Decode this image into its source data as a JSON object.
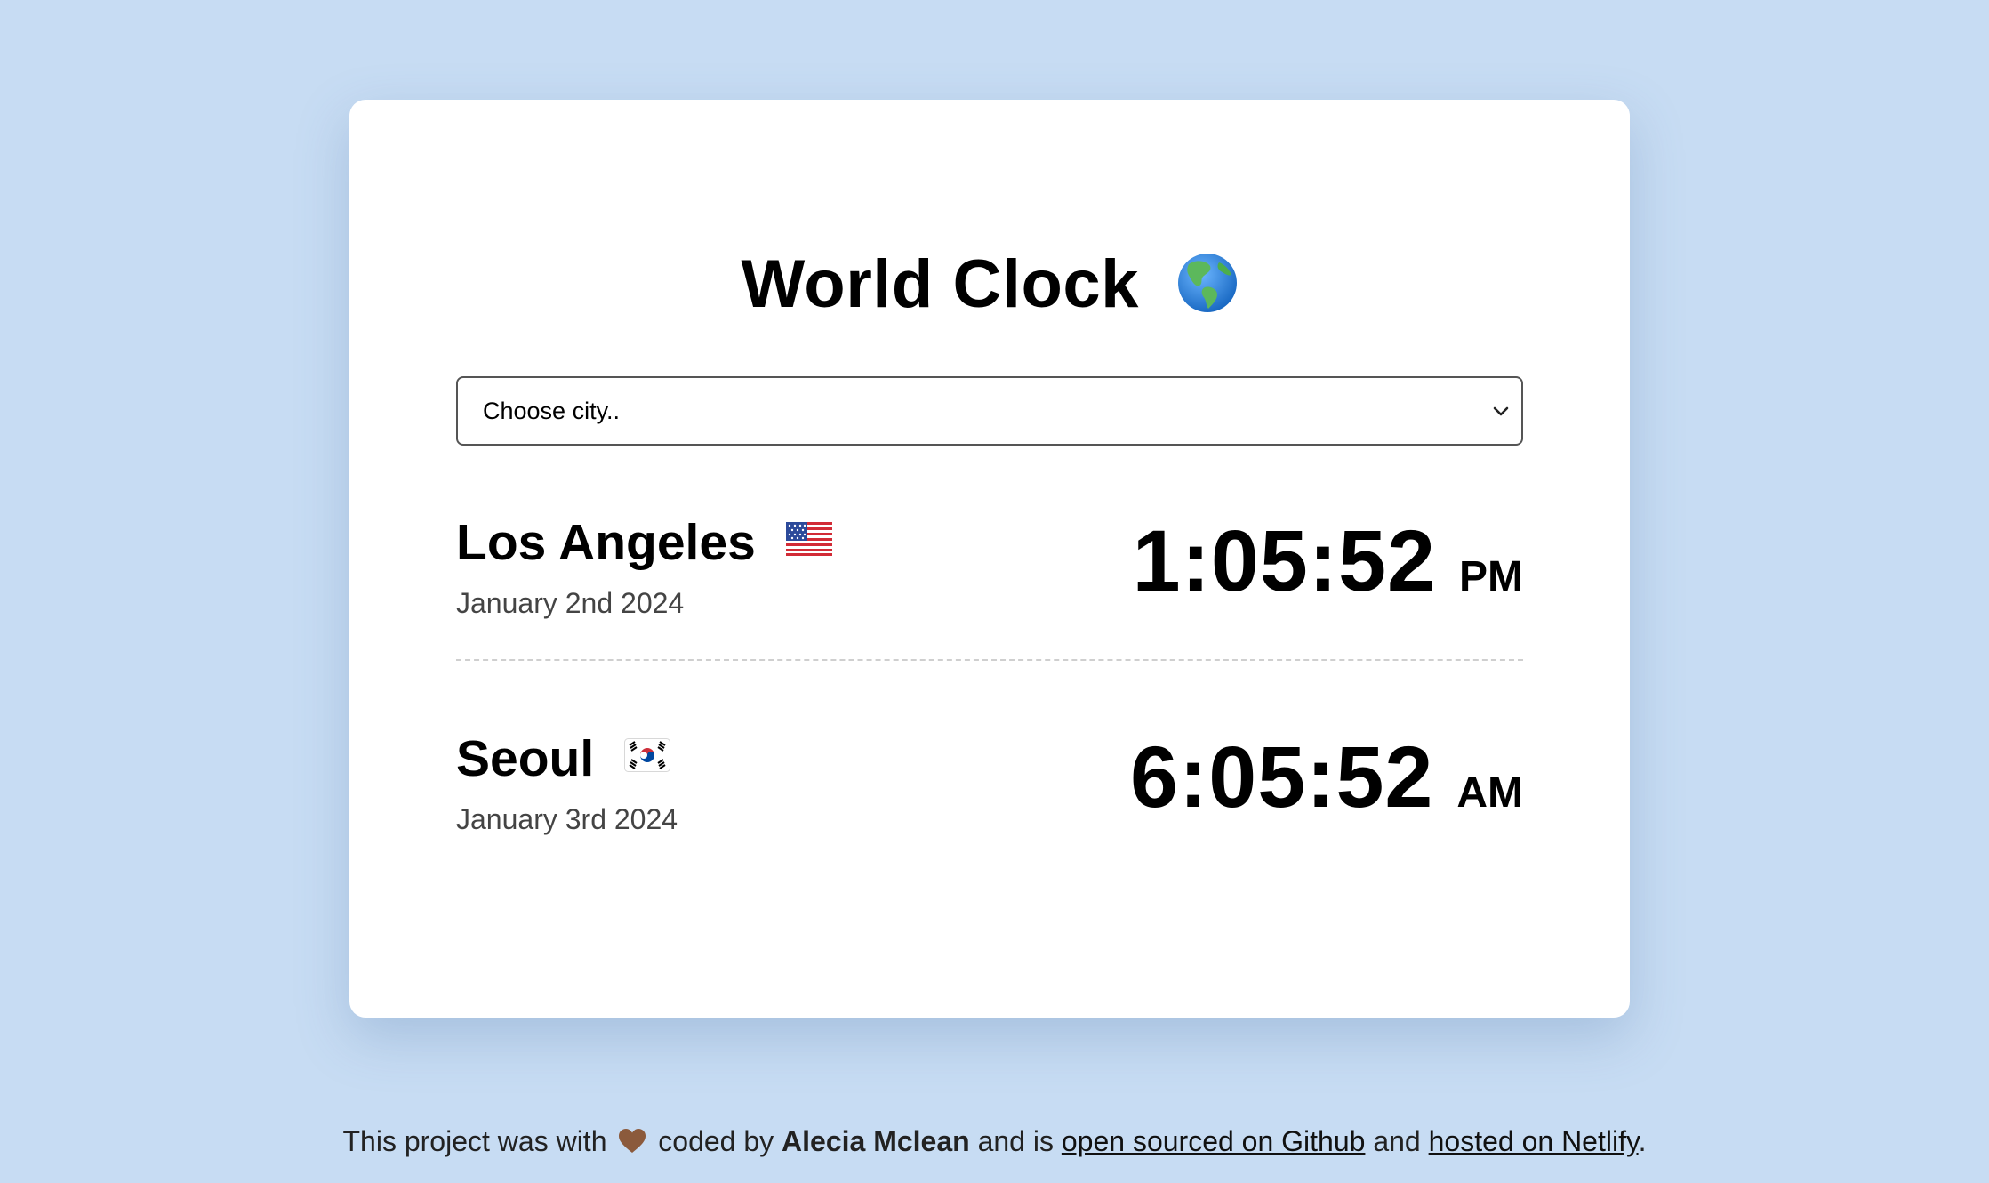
{
  "app": {
    "title": "World Clock",
    "title_icon": "globe-americas-icon"
  },
  "city_select": {
    "value": "Choose city..",
    "icon": "chevron-down-icon"
  },
  "cities": [
    {
      "name": "Los Angeles",
      "flag_icon": "flag-us-icon",
      "date": "January 2nd 2024",
      "time": "1:05:52",
      "ampm": "PM"
    },
    {
      "name": "Seoul",
      "flag_icon": "flag-kr-icon",
      "date": "January 3rd 2024",
      "time": "6:05:52",
      "ampm": "AM"
    }
  ],
  "footer": {
    "text_1": "This project was with",
    "heart_icon": "brown-heart-icon",
    "text_2": "coded by",
    "author": "Alecia Mclean",
    "text_3": "and is",
    "github_link": "open sourced on Github",
    "text_4": "and",
    "netlify_link": "hosted on Netlify",
    "text_5": "."
  },
  "colors": {
    "background": "#c7dcf3",
    "card": "#ffffff",
    "text": "#000000",
    "date_text": "#444444",
    "divider": "#cfcfcf"
  }
}
